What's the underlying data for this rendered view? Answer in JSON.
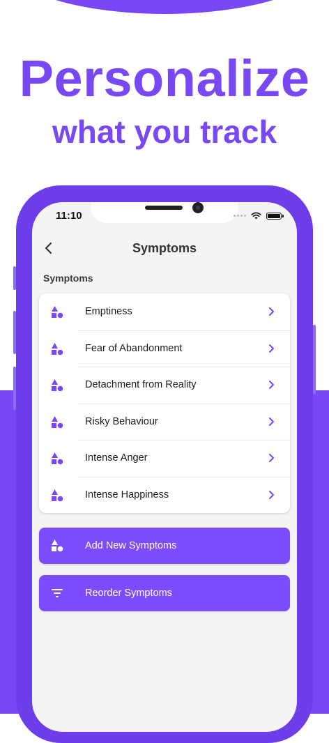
{
  "headline": {
    "line1": "Personalize",
    "line2": "what you track"
  },
  "status_bar": {
    "time": "11:10",
    "icons": [
      "signal-dots-icon",
      "wifi-icon",
      "battery-icon"
    ]
  },
  "nav": {
    "title": "Symptoms",
    "back_icon": "chevron-left-icon"
  },
  "section": {
    "label": "Symptoms"
  },
  "symptoms": [
    {
      "label": "Emptiness",
      "icon": "shapes-icon"
    },
    {
      "label": "Fear of Abandonment",
      "icon": "shapes-icon"
    },
    {
      "label": "Detachment from Reality",
      "icon": "shapes-icon"
    },
    {
      "label": "Risky Behaviour",
      "icon": "shapes-icon"
    },
    {
      "label": "Intense Anger",
      "icon": "shapes-icon"
    },
    {
      "label": "Intense Happiness",
      "icon": "shapes-icon"
    }
  ],
  "actions": {
    "add": {
      "label": "Add New Symptoms",
      "icon": "shapes-icon"
    },
    "reorder": {
      "label": "Reorder Symptoms",
      "icon": "filter-icon"
    }
  },
  "colors": {
    "accent": "#7748f4",
    "button": "#7c4dff",
    "background": "#f4f4f5"
  }
}
